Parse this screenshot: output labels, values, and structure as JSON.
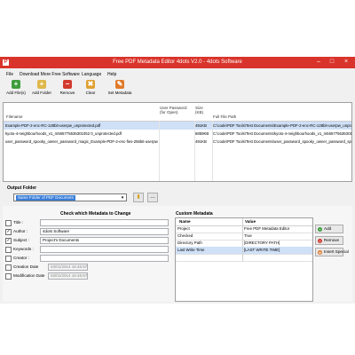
{
  "window": {
    "title": "Free PDF Metadata Editor 4dots V2.0 - 4dots Software"
  },
  "menu": [
    "File",
    "Download More Free Software",
    "Language",
    "Help"
  ],
  "toolbar": [
    {
      "label": "Add File(s)",
      "icon": "add-file-icon"
    },
    {
      "label": "Add Folder",
      "icon": "add-folder-icon"
    },
    {
      "label": "Remove",
      "icon": "remove-icon"
    },
    {
      "label": "Clear",
      "icon": "clear-icon"
    },
    {
      "label": "Set Metadata",
      "icon": "set-metadata-icon"
    }
  ],
  "files": {
    "headers": {
      "filename": "Filename",
      "user_password": "User Password (for Open)",
      "size": "Size (KB)",
      "fullpath": "Full File Path"
    },
    "rows": [
      {
        "filename": "Example-PDF-2-enc-RC-128bit-userpw_unprotected.pdf",
        "user_password": "",
        "size": "491KB",
        "fullpath": "C:\\code\\PDF Tools\\Test Documents\\Example-PDF-2-enc-RC-128bit-userpw_unprotected.pdf"
      },
      {
        "filename": "kyoto-4-neighbourhoods_v1_m565775636301052 0_unprotected.pdf",
        "user_password": "",
        "size": "6859KB",
        "fullpath": "C:\\code\\PDF Tools\\Test Documents\\kyoto-4-neighbourhoods_v1_m565775636301 05..."
      },
      {
        "filename": "user_password_spooky_owner_password_magic_Example-PDF-2-enc-fies-256bit-userpw.pdf",
        "user_password": "",
        "size": "491KB",
        "fullpath": "C:\\code\\PDF Tools\\Test Documents\\user_password_spooky_owner_password_spooky..."
      }
    ]
  },
  "output_folder": {
    "label": "Output Folder",
    "value": "Same Folder of PDF Document"
  },
  "metadata": {
    "header": "Check which Metadata to Change",
    "fields": [
      {
        "label": "Title :",
        "checked": false,
        "value": ""
      },
      {
        "label": "Author :",
        "checked": true,
        "value": "4dots Software"
      },
      {
        "label": "Subject :",
        "checked": true,
        "value": "Project's Documents"
      },
      {
        "label": "Keywords :",
        "checked": false,
        "value": ""
      },
      {
        "label": "Creator :",
        "checked": false,
        "value": ""
      },
      {
        "label": "Creation Date",
        "checked": false,
        "value": "03/01/2014 16:46:57"
      },
      {
        "label": "Modification Date",
        "checked": false,
        "value": "03/01/2014 16:46:57"
      }
    ]
  },
  "custom_metadata": {
    "label": "Custom Metadata",
    "headers": {
      "name": "Name",
      "value": "Value"
    },
    "rows": [
      {
        "name": "Project",
        "value": "Free PDF Metadata Editor"
      },
      {
        "name": "Checked",
        "value": "True"
      },
      {
        "name": "Directory Path",
        "value": "[DIRECTORY PATH]"
      },
      {
        "name": "Last Write Time",
        "value": "[LAST WRITE TIME]"
      }
    ],
    "buttons": {
      "add": "Add",
      "remove": "Remove",
      "insert_special": "Insert Special"
    }
  },
  "colors": {
    "titlebar": "#d9342b",
    "selection": "#cfe0f7",
    "accent": "#3a7ed8"
  }
}
